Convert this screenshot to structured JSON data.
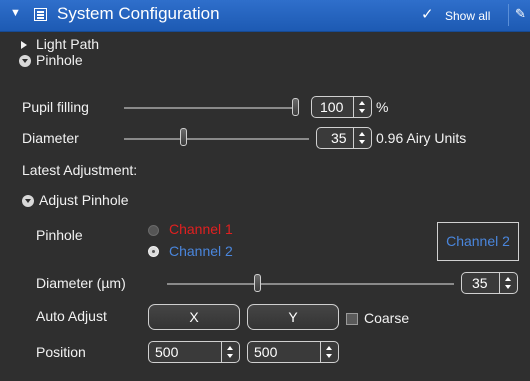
{
  "header": {
    "title": "System Configuration",
    "show_all_label": "Show all",
    "check_glyph": "✓",
    "edit_glyph": "✎"
  },
  "tree": {
    "light_path": "Light Path",
    "pinhole": "Pinhole"
  },
  "pupil_filling": {
    "label": "Pupil filling",
    "value": "100",
    "unit": "%",
    "level": 1.0
  },
  "diameter": {
    "label": "Diameter",
    "value": "35",
    "unit": "0.96 Airy Units",
    "level": 0.35
  },
  "latest_adjustment": "Latest Adjustment:",
  "adjust_pinhole": {
    "title": "Adjust Pinhole",
    "pinhole_label": "Pinhole",
    "channels": [
      {
        "label": "Channel 1",
        "selected": false,
        "color": "#e02020"
      },
      {
        "label": "Channel 2",
        "selected": true,
        "color": "#4a86dc"
      }
    ],
    "channel_display": "Channel 2",
    "diameter_label": "Diameter (µm)",
    "diameter_value": "35",
    "diameter_level": 0.35,
    "auto_adjust_label": "Auto Adjust",
    "x_button": "X",
    "y_button": "Y",
    "coarse_label": "Coarse",
    "coarse_checked": false,
    "position_label": "Position",
    "position_x": "500",
    "position_y": "500"
  },
  "colors": {
    "header_blue": "#2566c4",
    "panel_bg": "#2f2f2f",
    "channel1_red": "#e02020",
    "channel2_blue": "#4a86dc"
  }
}
